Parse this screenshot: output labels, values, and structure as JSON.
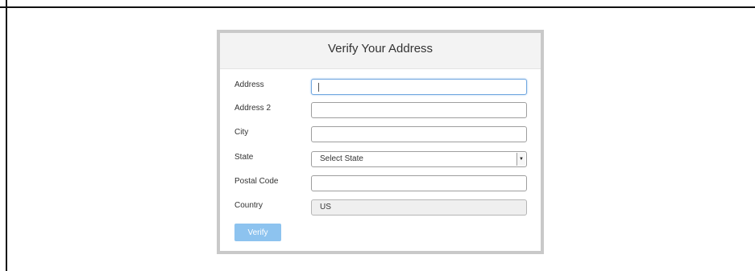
{
  "modal": {
    "title": "Verify Your Address"
  },
  "form": {
    "address": {
      "label": "Address",
      "value": ""
    },
    "address2": {
      "label": "Address 2",
      "value": ""
    },
    "city": {
      "label": "City",
      "value": ""
    },
    "state": {
      "label": "State",
      "selected": "Select State"
    },
    "postal": {
      "label": "Postal Code",
      "value": ""
    },
    "country": {
      "label": "Country",
      "value": "US"
    }
  },
  "actions": {
    "verify_label": "Verify"
  },
  "colors": {
    "verify_button": "#8dc3ef",
    "focus_border": "#72a8e0",
    "header_bg": "#f3f3f3"
  }
}
